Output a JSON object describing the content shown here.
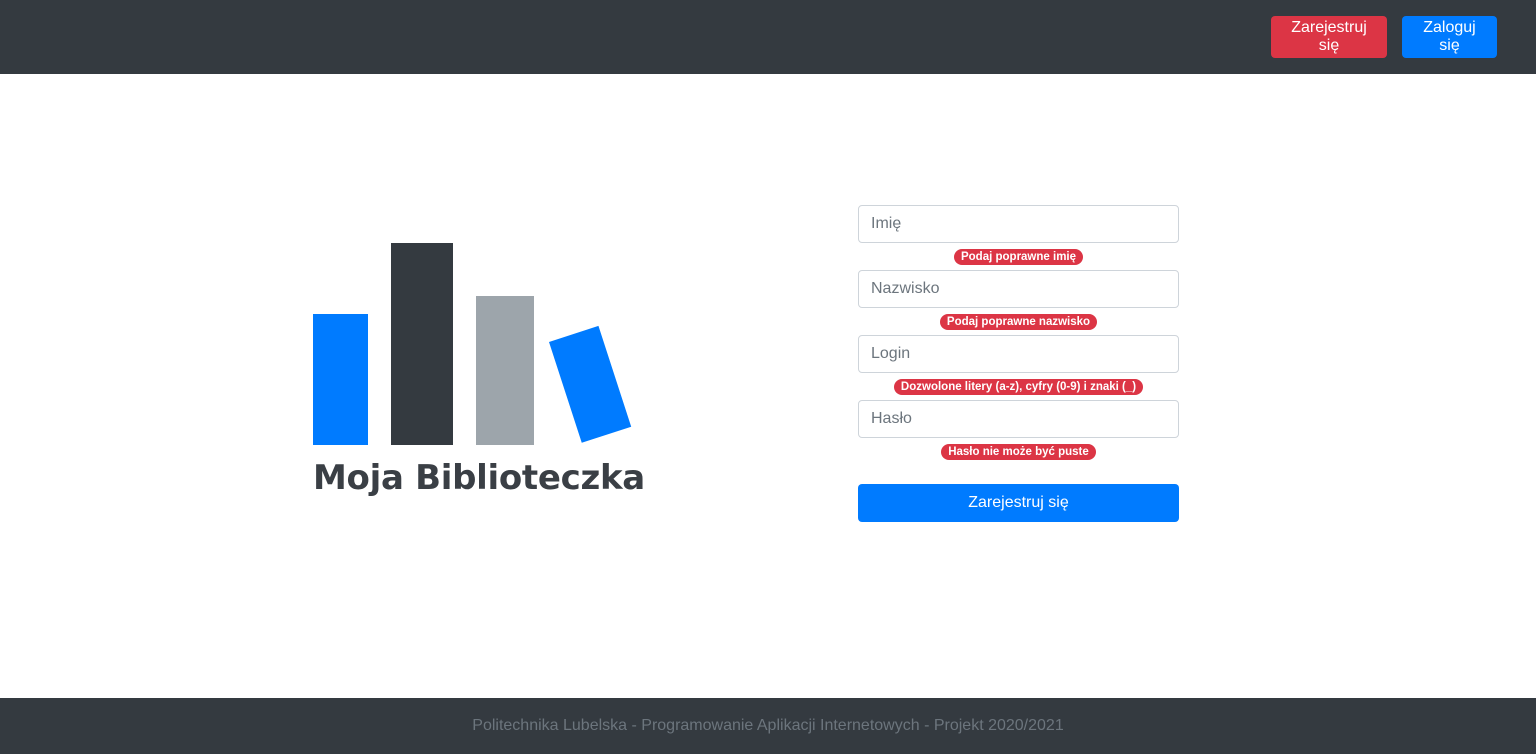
{
  "navbar": {
    "register_label": "Zarejestruj się",
    "login_label": "Zaloguj się"
  },
  "logo": {
    "title": "Moja Biblioteczka",
    "colors": {
      "blue": "#007bff",
      "dark": "#343a40",
      "gray": "#9da5ab"
    }
  },
  "form": {
    "first_name": {
      "placeholder": "Imię",
      "value": "",
      "error": "Podaj poprawne imię"
    },
    "last_name": {
      "placeholder": "Nazwisko",
      "value": "",
      "error": "Podaj poprawne nazwisko"
    },
    "login": {
      "placeholder": "Login",
      "value": "",
      "error": "Dozwolone litery (a-z), cyfry (0-9) i znaki (_)"
    },
    "password": {
      "placeholder": "Hasło",
      "value": "",
      "error": "Hasło nie może być puste"
    },
    "submit_label": "Zarejestruj się"
  },
  "footer": {
    "text": "Politechnika Lubelska - Programowanie Aplikacji Internetowych - Projekt 2020/2021"
  },
  "colors": {
    "navbar_bg": "#343a40",
    "primary": "#007bff",
    "danger": "#dc3545"
  }
}
